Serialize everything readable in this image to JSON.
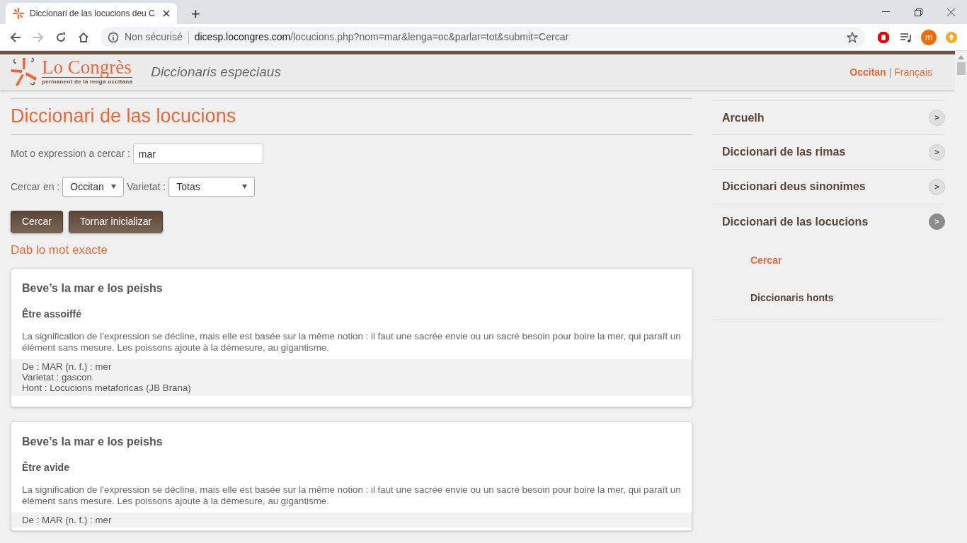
{
  "browser": {
    "tab_title": "Diccionari de las locucions deu C",
    "new_tab": "+",
    "security": "Non sécurisé",
    "url_host": "dicesp.locongres.com",
    "url_path": "/locucions.php?nom=mar&lenga=oc&parlar=tot&submit=Cercar",
    "profile_initial": "m"
  },
  "header": {
    "logo_title": "Lo Congrès",
    "logo_subtitle": "permanent de la lenga occitana",
    "site_title": "Diccionaris especiaus",
    "separator": "|",
    "languages": [
      {
        "label": "Occitan",
        "selected": true
      },
      {
        "label": "Français",
        "selected": false
      }
    ]
  },
  "main": {
    "heading": "Diccionari de las locucions",
    "search": {
      "label": "Mot o expression a cercar :",
      "value": "mar"
    },
    "language_select": {
      "label": "Cercar en :",
      "value": "Occitan"
    },
    "variety_select": {
      "label": "Varietat :",
      "value": "Totas"
    },
    "buttons": [
      "Cercar",
      "Tornar inicializar"
    ],
    "results_heading": "Dab lo mot exacte",
    "results": [
      {
        "title": "Beve’s la mar e los peishs",
        "translation": "Être assoiffé",
        "explanation": "La signification de l’expression se décline, mais elle est basée sur la même notion : il faut une sacrée envie ou un sacré besoin pour boire la mer, qui paraît un élément sans mesure. Les poissons ajoute à la démesure, au gigantisme.",
        "details": [
          "De : MAR (n. f.) : mer",
          "Varietat : gascon",
          "Hont : Locucions metaforicas (JB Brana)"
        ]
      },
      {
        "title": "Beve’s la mar e los peishs",
        "translation": "Être avide",
        "explanation": "La signification de l’expression se décline, mais elle est basée sur la même notion : il faut une sacrée envie ou un sacré besoin pour boire la mer, qui paraît un élément sans mesure. Les poissons ajoute à la démesure, au gigantisme.",
        "details": [
          "De : MAR (n. f.) : mer"
        ]
      }
    ]
  },
  "sidebar": {
    "items": [
      {
        "label": "Arcuelh",
        "expanded": false,
        "arrow": ">"
      },
      {
        "label": "Diccionari de las rimas",
        "expanded": false,
        "arrow": ">"
      },
      {
        "label": "Diccionari deus sinonimes",
        "expanded": false,
        "arrow": ">"
      },
      {
        "label": "Diccionari de las locucions",
        "expanded": true,
        "arrow": ">",
        "children": [
          {
            "label": "Cercar",
            "selected": true
          },
          {
            "label": "Diccionaris honts",
            "selected": false
          }
        ]
      }
    ]
  }
}
